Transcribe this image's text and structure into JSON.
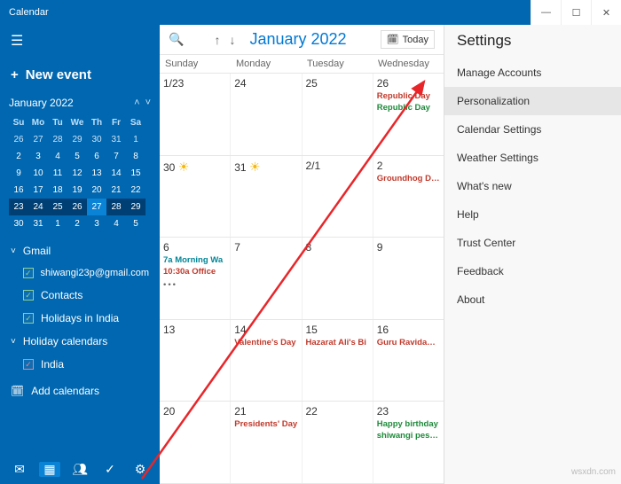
{
  "title": "Calendar",
  "winbtns": {
    "min": "—",
    "max": "☐",
    "close": "✕"
  },
  "sidebar": {
    "newevent_plus": "+",
    "newevent": "New event",
    "mini_month": "January 2022",
    "dow": [
      "Su",
      "Mo",
      "Tu",
      "We",
      "Th",
      "Fr",
      "Sa"
    ],
    "mini_rows": [
      [
        "26",
        "27",
        "28",
        "29",
        "30",
        "31",
        "1"
      ],
      [
        "2",
        "3",
        "4",
        "5",
        "6",
        "7",
        "8"
      ],
      [
        "9",
        "10",
        "11",
        "12",
        "13",
        "14",
        "15"
      ],
      [
        "16",
        "17",
        "18",
        "19",
        "20",
        "21",
        "22"
      ],
      [
        "23",
        "24",
        "25",
        "26",
        "27",
        "28",
        "29"
      ],
      [
        "30",
        "31",
        "1",
        "2",
        "3",
        "4",
        "5"
      ]
    ],
    "gmail_label": "Gmail",
    "gmail_account": "shiwangi23p@gmail.com",
    "contacts": "Contacts",
    "holidays_india": "Holidays in India",
    "holiday_calendars": "Holiday calendars",
    "india": "India",
    "add_calendars": "Add calendars"
  },
  "header": {
    "month": "January 2022",
    "today": "Today"
  },
  "dayheads": [
    "Sunday",
    "Monday",
    "Tuesday",
    "Wednesday"
  ],
  "weeks": [
    {
      "days": [
        {
          "num": "1/23"
        },
        {
          "num": "24"
        },
        {
          "num": "25"
        },
        {
          "num": "26",
          "events": [
            {
              "t": "Republic Day",
              "c": "red"
            },
            {
              "t": "Republic Day",
              "c": "green"
            }
          ]
        }
      ]
    },
    {
      "days": [
        {
          "num": "30",
          "sun": true
        },
        {
          "num": "31",
          "sun": true
        },
        {
          "num": "2/1"
        },
        {
          "num": "2",
          "events": [
            {
              "t": "Groundhog Day",
              "c": "red"
            }
          ]
        }
      ]
    },
    {
      "days": [
        {
          "num": "6",
          "events": [
            {
              "t": "7a Morning Wa",
              "c": "teal"
            },
            {
              "t": "10:30a Office",
              "c": "red"
            },
            {
              "t": "",
              "c": ""
            },
            {
              "t": "•••",
              "c": "dots"
            }
          ]
        },
        {
          "num": "7"
        },
        {
          "num": "8"
        },
        {
          "num": "9"
        }
      ]
    },
    {
      "days": [
        {
          "num": "13"
        },
        {
          "num": "14",
          "events": [
            {
              "t": "Valentine's Day",
              "c": "red"
            }
          ]
        },
        {
          "num": "15",
          "events": [
            {
              "t": "Hazarat Ali's Bi",
              "c": "red"
            }
          ]
        },
        {
          "num": "16",
          "events": [
            {
              "t": "Guru Ravidas Ja",
              "c": "red"
            }
          ]
        }
      ]
    },
    {
      "days": [
        {
          "num": "20"
        },
        {
          "num": "21",
          "events": [
            {
              "t": "Presidents' Day",
              "c": "red"
            }
          ]
        },
        {
          "num": "22"
        },
        {
          "num": "23",
          "events": [
            {
              "t": "Happy birthday",
              "c": "green"
            },
            {
              "t": "shiwangi peswa",
              "c": "green"
            }
          ]
        }
      ]
    }
  ],
  "settings": {
    "title": "Settings",
    "items": [
      "Manage Accounts",
      "Personalization",
      "Calendar Settings",
      "Weather Settings",
      "What's new",
      "Help",
      "Trust Center",
      "Feedback",
      "About"
    ],
    "selected_index": 1
  },
  "watermark": "wsxdn.com"
}
